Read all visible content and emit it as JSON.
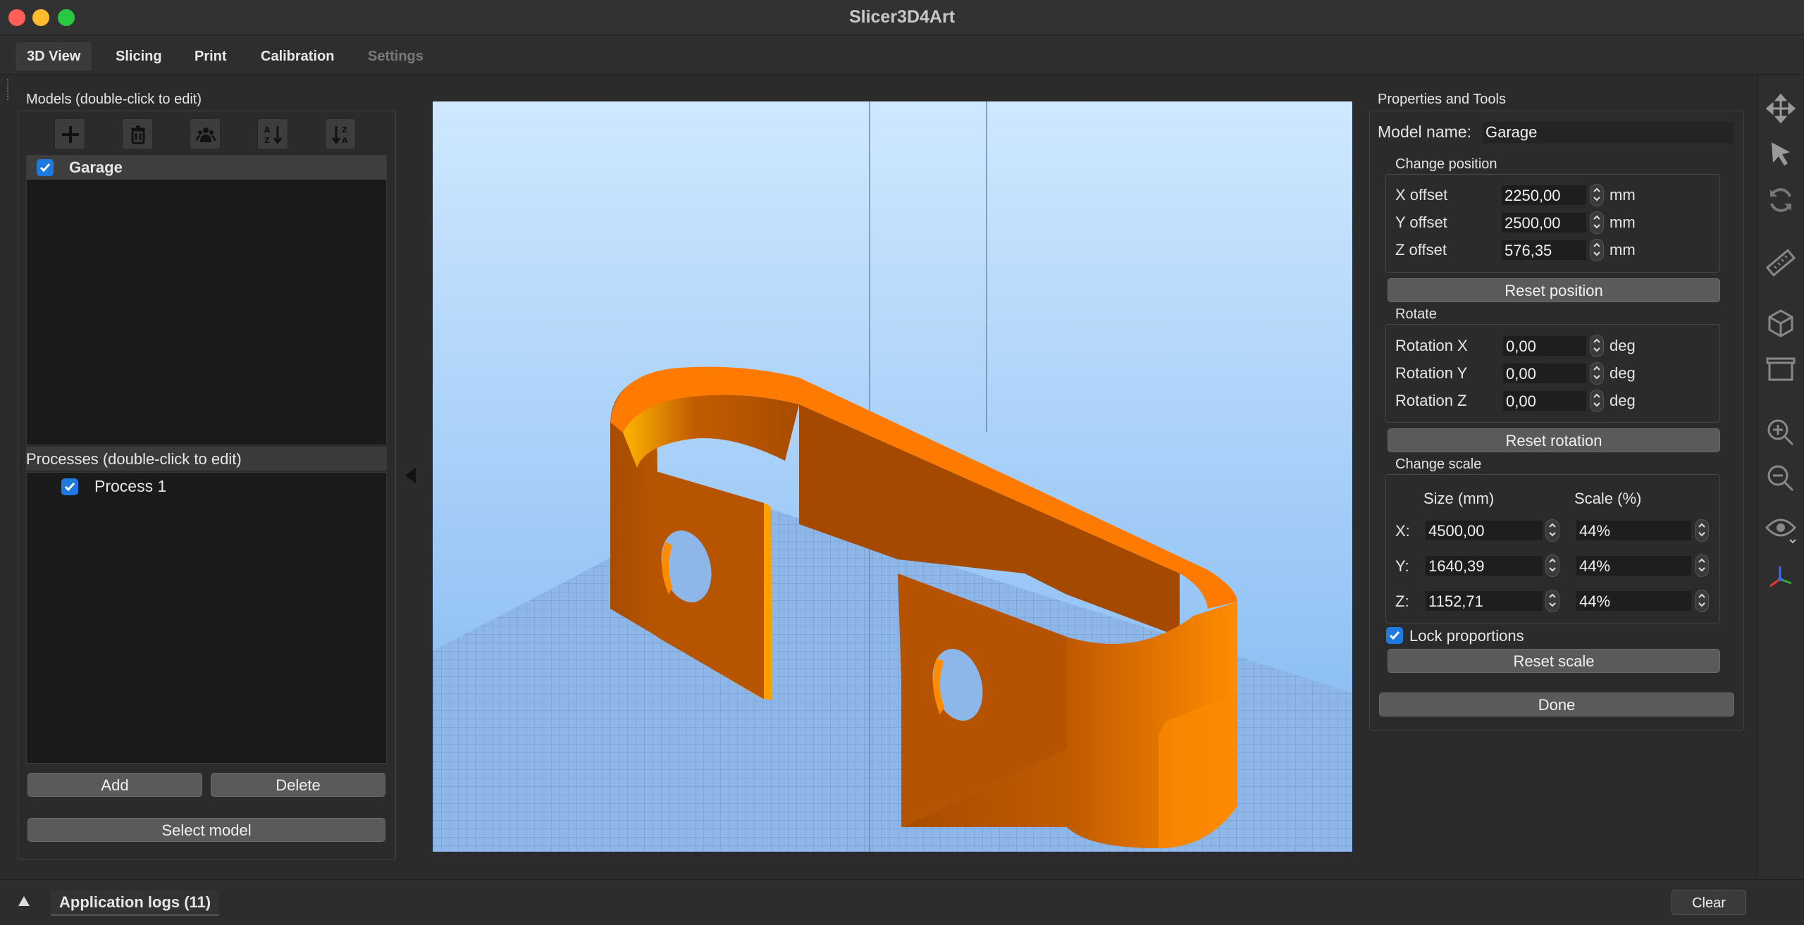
{
  "window": {
    "title": "Slicer3D4Art",
    "controls": {
      "close_color": "#ff5f57",
      "minimize_color": "#febc2e",
      "zoom_color": "#28c840"
    }
  },
  "tabs": [
    {
      "label": "3D View",
      "state": "active"
    },
    {
      "label": "Slicing",
      "state": "normal"
    },
    {
      "label": "Print",
      "state": "normal"
    },
    {
      "label": "Calibration",
      "state": "normal"
    },
    {
      "label": "Settings",
      "state": "disabled"
    }
  ],
  "models_panel": {
    "title": "Models (double-click to edit)",
    "toolbar_icons": [
      "add-icon",
      "trash-icon",
      "group-icon",
      "sort-az-icon",
      "sort-za-icon"
    ],
    "items": [
      {
        "name": "Garage",
        "checked": true
      }
    ]
  },
  "processes_panel": {
    "title": "Processes (double-click to edit)",
    "items": [
      {
        "name": "Process 1",
        "checked": true
      }
    ],
    "add_label": "Add",
    "delete_label": "Delete",
    "select_model_label": "Select model"
  },
  "properties": {
    "title": "Properties and Tools",
    "model_name_label": "Model name:",
    "model_name": "Garage",
    "position": {
      "title": "Change position",
      "rows": [
        {
          "label": "X offset",
          "value": "2250,00",
          "unit": "mm"
        },
        {
          "label": "Y offset",
          "value": "2500,00",
          "unit": "mm"
        },
        {
          "label": "Z offset",
          "value": "576,35",
          "unit": "mm"
        }
      ],
      "reset_label": "Reset position"
    },
    "rotation": {
      "title": "Rotate",
      "rows": [
        {
          "label": "Rotation X",
          "value": "0,00",
          "unit": "deg"
        },
        {
          "label": "Rotation Y",
          "value": "0,00",
          "unit": "deg"
        },
        {
          "label": "Rotation Z",
          "value": "0,00",
          "unit": "deg"
        }
      ],
      "reset_label": "Reset rotation"
    },
    "scale": {
      "title": "Change scale",
      "size_header": "Size (mm)",
      "scale_header": "Scale (%)",
      "rows": [
        {
          "axis": "X:",
          "size": "4500,00",
          "scale": "44%"
        },
        {
          "axis": "Y:",
          "size": "1640,39",
          "scale": "44%"
        },
        {
          "axis": "Z:",
          "size": "1152,71",
          "scale": "44%"
        }
      ],
      "lock_label": "Lock proportions",
      "lock_checked": true,
      "reset_label": "Reset scale"
    },
    "done_label": "Done"
  },
  "right_toolbar_icons": [
    "move-icon",
    "select-cursor-icon",
    "rotate-icon",
    "ruler-icon",
    "cube-icon",
    "box-icon",
    "zoom-in-icon",
    "zoom-out-icon",
    "eye-icon",
    "axes-icon"
  ],
  "statusbar": {
    "logs_label": "Application logs (11)",
    "clear_label": "Clear"
  },
  "colors": {
    "model_orange": "#ff7a00",
    "viewport_sky": "#c9e6ff",
    "bed_blue": "#8db7e8",
    "accent_blue": "#1f7ae0"
  }
}
